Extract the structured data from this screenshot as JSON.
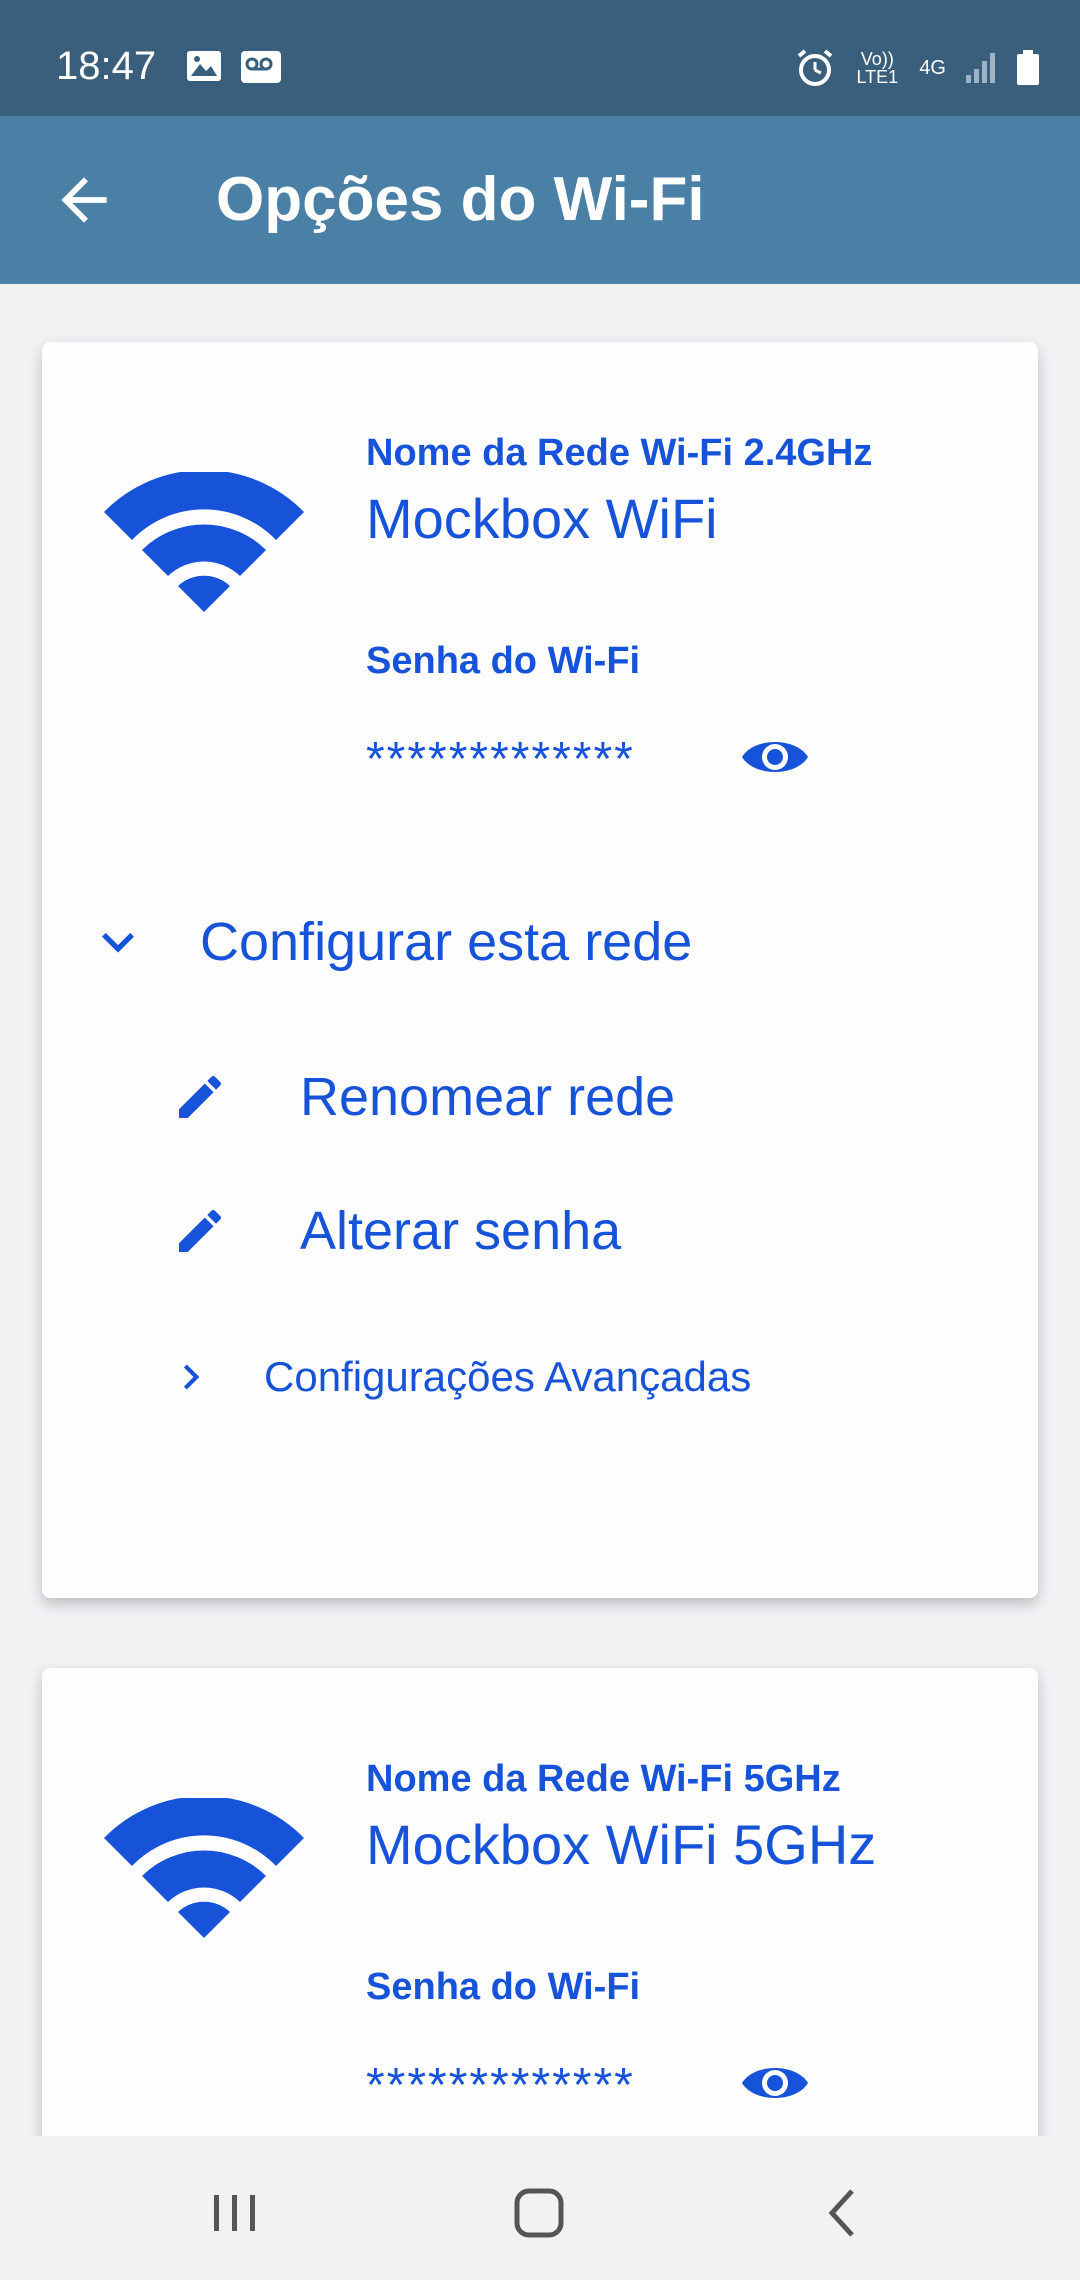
{
  "status_bar": {
    "time": "18:47",
    "icons": [
      "image-icon",
      "voicemail-icon",
      "alarm-icon",
      "volte-icon",
      "4g-icon",
      "signal-icon",
      "battery-icon"
    ],
    "volte_text": "Vo)) LTE1",
    "network_text": "4G"
  },
  "app_bar": {
    "title": "Opções do Wi-Fi",
    "background": "#4a7fa6"
  },
  "accent_color": "#1653d9",
  "networks": [
    {
      "name_label": "Nome da Rede Wi-Fi 2.4GHz",
      "name": "Mockbox WiFi",
      "password_label": "Senha do Wi-Fi",
      "password_masked": "*************",
      "configure_label": "Configurar esta rede",
      "rename_label": "Renomear rede",
      "change_password_label": "Alterar senha",
      "advanced_label": "Configurações Avançadas"
    },
    {
      "name_label": "Nome da Rede Wi-Fi 5GHz",
      "name": "Mockbox WiFi 5GHz",
      "password_label": "Senha do Wi-Fi",
      "password_masked": "*************"
    }
  ],
  "nav_bar": {
    "buttons": [
      "recents-icon",
      "home-icon",
      "back-icon"
    ]
  }
}
